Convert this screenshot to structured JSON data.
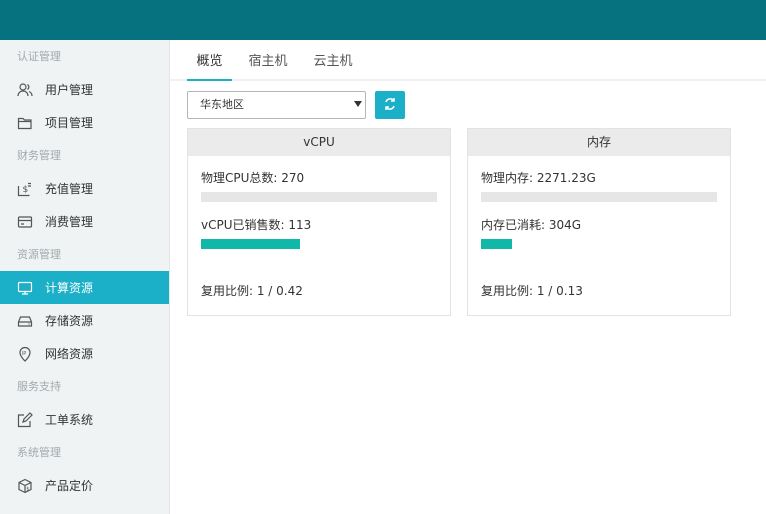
{
  "colors": {
    "topbar": "#06717f",
    "accent": "#1bb0c8",
    "bar_fill": "#12b8a7",
    "bar_track": "#e6e6e6"
  },
  "sidebar": {
    "groups": [
      {
        "title": "认证管理",
        "items": [
          {
            "label": "用户管理",
            "icon": "user-icon"
          },
          {
            "label": "项目管理",
            "icon": "folder-icon"
          }
        ]
      },
      {
        "title": "财务管理",
        "items": [
          {
            "label": "充值管理",
            "icon": "recharge-icon"
          },
          {
            "label": "消费管理",
            "icon": "card-icon"
          }
        ]
      },
      {
        "title": "资源管理",
        "items": [
          {
            "label": "计算资源",
            "icon": "monitor-icon",
            "active": true
          },
          {
            "label": "存储资源",
            "icon": "storage-icon"
          },
          {
            "label": "网络资源",
            "icon": "ip-pin-icon"
          }
        ]
      },
      {
        "title": "服务支持",
        "items": [
          {
            "label": "工单系统",
            "icon": "edit-icon"
          }
        ]
      },
      {
        "title": "系统管理",
        "items": [
          {
            "label": "产品定价",
            "icon": "box-icon"
          }
        ]
      }
    ]
  },
  "tabs": [
    {
      "label": "概览",
      "active": true
    },
    {
      "label": "宿主机"
    },
    {
      "label": "云主机"
    }
  ],
  "region_select": {
    "value": "华东地区"
  },
  "cards": {
    "vcpu": {
      "title": "vCPU",
      "total_text": "物理CPU总数: 270",
      "used_text": "vCPU已销售数: 113",
      "ratio_text": "复用比例: 1 / 0.42",
      "used_fraction": 0.42
    },
    "memory": {
      "title": "内存",
      "total_text": "物理内存: 2271.23G",
      "used_text": "内存已消耗: 304G",
      "ratio_text": "复用比例: 1 / 0.13",
      "used_fraction": 0.13
    }
  }
}
